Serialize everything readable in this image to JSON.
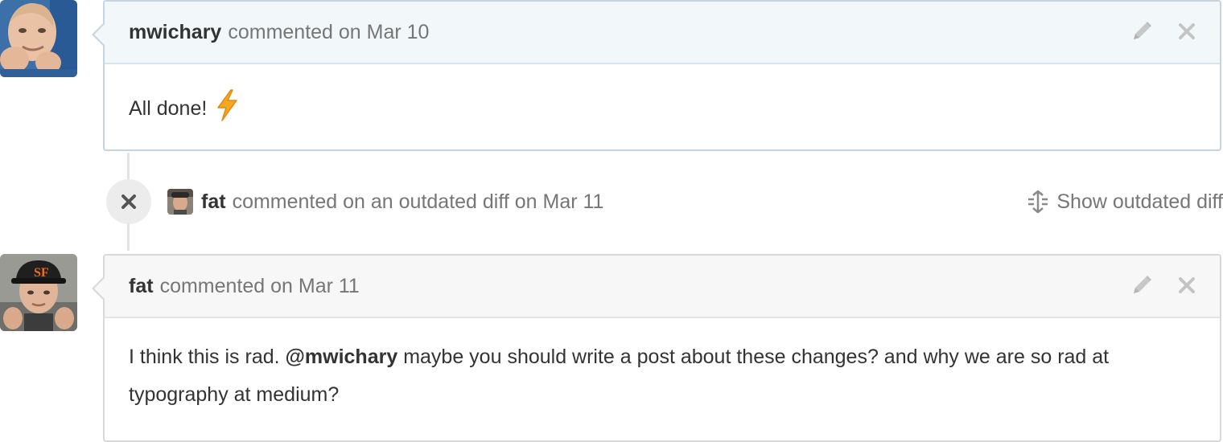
{
  "comments": [
    {
      "author": "mwichary",
      "meta": "commented on Mar 10",
      "body_text": "All done!",
      "body_emoji": "zap"
    },
    {
      "author": "fat",
      "meta": "commented on Mar 11",
      "body_before": "I think this is rad.",
      "mention": "@mwichary",
      "body_after": "maybe you should write a post about these changes? and why we are so rad at typography at medium?"
    }
  ],
  "timeline_event": {
    "author": "fat",
    "text": "commented on an outdated diff on Mar 11",
    "badge_icon": "x-icon",
    "action_label": "Show outdated diff",
    "action_icon": "unfold-icon"
  },
  "colors": {
    "header_blue": "#f2f8fa",
    "header_gray": "#f7f7f7",
    "border_blue": "#c6d4df",
    "border_gray": "#d8d8d8",
    "muted_text": "#767676",
    "zap": "#f5a623"
  }
}
